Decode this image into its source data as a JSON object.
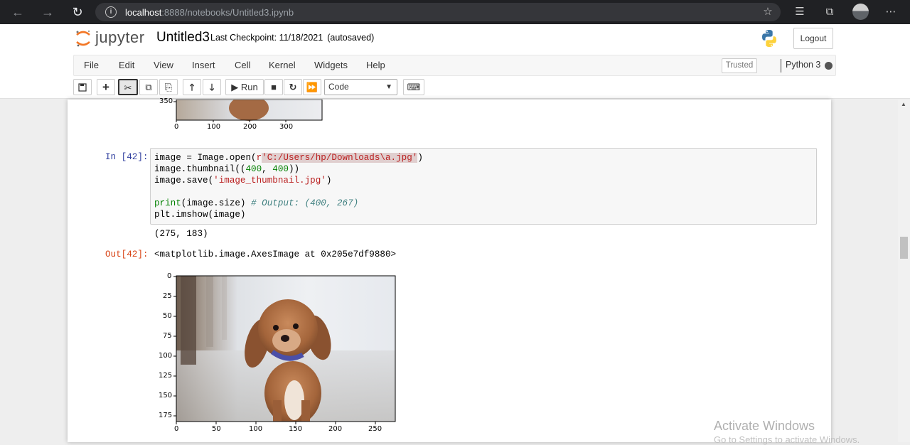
{
  "browser": {
    "url_host": "localhost",
    "url_rest": ":8888/notebooks/Untitled3.ipynb"
  },
  "header": {
    "logo_text": "jupyter",
    "notebook_name": "Untitled3",
    "checkpoint": "Last Checkpoint: 11/18/2021",
    "autosave": "(autosaved)",
    "logout_label": "Logout"
  },
  "menu": {
    "items": [
      "File",
      "Edit",
      "View",
      "Insert",
      "Cell",
      "Kernel",
      "Widgets",
      "Help"
    ],
    "trusted": "Trusted",
    "kernel": "Python 3"
  },
  "toolbar": {
    "run_label": "Run",
    "cell_type": "Code"
  },
  "prev_plot": {
    "y_tick": "350",
    "x_ticks": [
      "0",
      "100",
      "200",
      "300"
    ]
  },
  "cell": {
    "in_prompt": "In [42]:",
    "out_prompt": "Out[42]:",
    "stdout": "(275, 183)",
    "out_repr": "<matplotlib.image.AxesImage at 0x205e7df9880>",
    "code": {
      "l1_a": "image = Image.open(",
      "l1_r": "r",
      "l1_q1": "'",
      "l1_path": "C:/Users/hp/Downloads\\a.jpg",
      "l1_q2": "'",
      "l1_end": ")",
      "l2_a": "image.thumbnail((",
      "l2_n1": "400",
      "l2_b": ", ",
      "l2_n2": "400",
      "l2_c": "))",
      "l3_a": "image.save(",
      "l3_s": "'image_thumbnail.jpg'",
      "l3_c": ")",
      "l5_kw": "print",
      "l5_a": "(image.size) ",
      "l5_cmt": "# Output: (400, 267)",
      "l6": "plt.imshow(image)"
    }
  },
  "plot": {
    "y_ticks": [
      "0",
      "25",
      "50",
      "75",
      "100",
      "125",
      "150",
      "175"
    ],
    "x_ticks": [
      "0",
      "50",
      "100",
      "150",
      "200",
      "250"
    ]
  },
  "watermark": {
    "line1": "Activate Windows",
    "line2": "Go to Settings to activate Windows."
  }
}
